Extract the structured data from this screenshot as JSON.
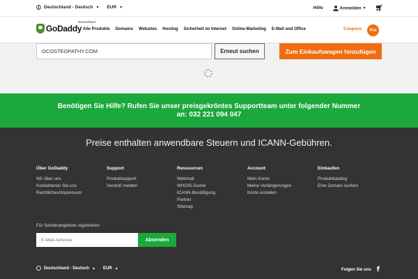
{
  "utility": {
    "language": "Deutschland - Deutsch",
    "currency": "EUR",
    "help": "Hilfe",
    "signin": "Anmelden"
  },
  "brand": {
    "name": "GoDaddy",
    "region": "Deutschland"
  },
  "nav": {
    "items": [
      "Alle Produkte",
      "Domains",
      "Websites",
      "Hosting",
      "Sicherheit im Internet",
      "Online-Marketing",
      "E-Mail und Office"
    ],
    "coupons": "Coupons",
    "pro": "Pro"
  },
  "search": {
    "value": "OCOSTEOPATHY.COM",
    "retry_label": "Erneut suchen",
    "cart_label": "Zum Einkaufswagen hinzufügen"
  },
  "support": {
    "line1": "Benötigen Sie Hilfe?  Rufen Sie unser preisgekröntes Supportteam unter folgender Nummer",
    "line2": "an: 032 221 094 047"
  },
  "footer": {
    "prices_note": "Preise enthalten anwendbare Steuern und ICANN-Gebühren.",
    "columns": [
      {
        "title": "Über GoDaddy",
        "links": [
          "Wir über uns",
          "Kontaktieren Sie uns",
          "Rechtliches/Impressum"
        ]
      },
      {
        "title": "Support",
        "links": [
          "Produktsupport",
          "Verstoß melden"
        ]
      },
      {
        "title": "Ressourcen",
        "links": [
          "Webmail",
          "WHOIS-Suche",
          "ICANN-Bestätigung",
          "Partner",
          "Sitemap"
        ]
      },
      {
        "title": "Account",
        "links": [
          "Mein Konto",
          "Meine Verlängerungen",
          "Konto erstellen"
        ]
      },
      {
        "title": "Einkaufen",
        "links": [
          "Produktkatalog",
          "Eine Domain suchen"
        ]
      }
    ],
    "signup_label": "Für Sonderangebote registrieren",
    "email_placeholder": "E-Mail-Adresse",
    "send_label": "Absenden",
    "language": "Deutschland - Deutsch",
    "currency": "EUR",
    "follow": "Folgen Sie uns",
    "social_icon": "f"
  },
  "colors": {
    "accent": "#ef6c0f",
    "green": "#1ba83c",
    "footer_bg": "#333333"
  }
}
